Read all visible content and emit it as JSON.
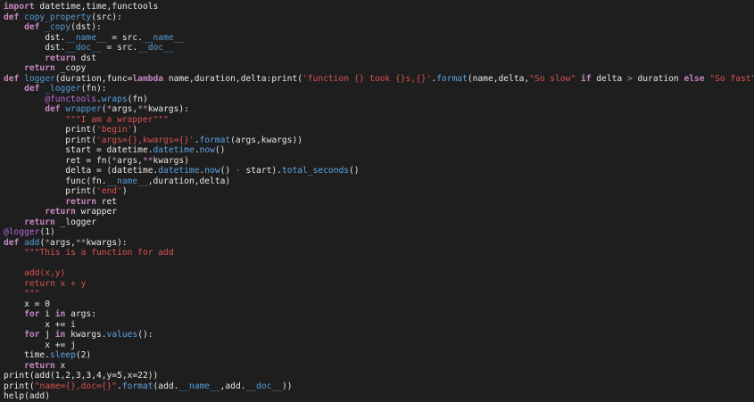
{
  "editor": {
    "language": "python",
    "colors": {
      "background": "#1e1e1e",
      "text": "#e8e8e8",
      "keyword": "#c586c0",
      "function": "#569cd6",
      "string": "#d9534f",
      "decorator": "#b96ad9"
    },
    "lines": [
      [
        {
          "t": "import",
          "c": "kw"
        },
        {
          "t": " datetime,time,functools",
          "c": ""
        }
      ],
      [
        {
          "t": "def",
          "c": "kw"
        },
        {
          "t": " ",
          "c": ""
        },
        {
          "t": "copy_property",
          "c": "fn"
        },
        {
          "t": "(src):",
          "c": ""
        }
      ],
      [
        {
          "t": "    ",
          "c": ""
        },
        {
          "t": "def",
          "c": "kw"
        },
        {
          "t": " ",
          "c": ""
        },
        {
          "t": "_copy",
          "c": "fn"
        },
        {
          "t": "(dst):",
          "c": ""
        }
      ],
      [
        {
          "t": "        dst.",
          "c": ""
        },
        {
          "t": "__name__",
          "c": "fn"
        },
        {
          "t": " = src.",
          "c": ""
        },
        {
          "t": "__name__",
          "c": "fn"
        }
      ],
      [
        {
          "t": "        dst.",
          "c": ""
        },
        {
          "t": "__doc__",
          "c": "fn"
        },
        {
          "t": " = src.",
          "c": ""
        },
        {
          "t": "__doc__",
          "c": "fn"
        }
      ],
      [
        {
          "t": "        ",
          "c": ""
        },
        {
          "t": "return",
          "c": "kw"
        },
        {
          "t": " dst",
          "c": ""
        }
      ],
      [
        {
          "t": "    ",
          "c": ""
        },
        {
          "t": "return",
          "c": "kw"
        },
        {
          "t": " _copy",
          "c": ""
        }
      ],
      [
        {
          "t": "def",
          "c": "kw"
        },
        {
          "t": " ",
          "c": ""
        },
        {
          "t": "logger",
          "c": "fn"
        },
        {
          "t": "(duration,func=",
          "c": ""
        },
        {
          "t": "lambda",
          "c": "kw"
        },
        {
          "t": " name,duration,delta:print(",
          "c": ""
        },
        {
          "t": "'function {} took {}s,{}'",
          "c": "str"
        },
        {
          "t": ".",
          "c": ""
        },
        {
          "t": "format",
          "c": "call"
        },
        {
          "t": "(name,delta,",
          "c": ""
        },
        {
          "t": "\"So slow\"",
          "c": "str"
        },
        {
          "t": " ",
          "c": ""
        },
        {
          "t": "if",
          "c": "kw"
        },
        {
          "t": " delta ",
          "c": ""
        },
        {
          "t": ">",
          "c": "op"
        },
        {
          "t": " duration ",
          "c": ""
        },
        {
          "t": "else",
          "c": "kw"
        },
        {
          "t": " ",
          "c": ""
        },
        {
          "t": "\"So fast\"",
          "c": "str"
        },
        {
          "t": "))):",
          "c": ""
        }
      ],
      [
        {
          "t": "    ",
          "c": ""
        },
        {
          "t": "def",
          "c": "kw"
        },
        {
          "t": " ",
          "c": ""
        },
        {
          "t": "_logger",
          "c": "fn"
        },
        {
          "t": "(fn):",
          "c": ""
        }
      ],
      [
        {
          "t": "        ",
          "c": ""
        },
        {
          "t": "@functools",
          "c": "dec"
        },
        {
          "t": ".",
          "c": ""
        },
        {
          "t": "wraps",
          "c": "call"
        },
        {
          "t": "(fn)",
          "c": ""
        }
      ],
      [
        {
          "t": "        ",
          "c": ""
        },
        {
          "t": "def",
          "c": "kw"
        },
        {
          "t": " ",
          "c": ""
        },
        {
          "t": "wrapper",
          "c": "fn"
        },
        {
          "t": "(",
          "c": ""
        },
        {
          "t": "*",
          "c": "op"
        },
        {
          "t": "args,",
          "c": ""
        },
        {
          "t": "**",
          "c": "op"
        },
        {
          "t": "kwargs):",
          "c": ""
        }
      ],
      [
        {
          "t": "            ",
          "c": ""
        },
        {
          "t": "\"\"\"I am a wrapper\"\"\"",
          "c": "str"
        }
      ],
      [
        {
          "t": "            print(",
          "c": ""
        },
        {
          "t": "'begin'",
          "c": "str"
        },
        {
          "t": ")",
          "c": ""
        }
      ],
      [
        {
          "t": "            print(",
          "c": ""
        },
        {
          "t": "'args={},kwargs={}'",
          "c": "str"
        },
        {
          "t": ".",
          "c": ""
        },
        {
          "t": "format",
          "c": "call"
        },
        {
          "t": "(args,kwargs))",
          "c": ""
        }
      ],
      [
        {
          "t": "            start = datetime.",
          "c": ""
        },
        {
          "t": "datetime",
          "c": "call"
        },
        {
          "t": ".",
          "c": ""
        },
        {
          "t": "now",
          "c": "call"
        },
        {
          "t": "()",
          "c": ""
        }
      ],
      [
        {
          "t": "            ret = fn(",
          "c": ""
        },
        {
          "t": "*",
          "c": "op"
        },
        {
          "t": "args,",
          "c": ""
        },
        {
          "t": "**",
          "c": "op"
        },
        {
          "t": "kwargs)",
          "c": ""
        }
      ],
      [
        {
          "t": "            delta = (datetime.",
          "c": ""
        },
        {
          "t": "datetime",
          "c": "call"
        },
        {
          "t": ".",
          "c": ""
        },
        {
          "t": "now",
          "c": "call"
        },
        {
          "t": "() ",
          "c": ""
        },
        {
          "t": "-",
          "c": "op"
        },
        {
          "t": " start).",
          "c": ""
        },
        {
          "t": "total_seconds",
          "c": "call"
        },
        {
          "t": "()",
          "c": ""
        }
      ],
      [
        {
          "t": "            func(fn.",
          "c": ""
        },
        {
          "t": "__name__",
          "c": "fn"
        },
        {
          "t": ",duration,delta)",
          "c": ""
        }
      ],
      [
        {
          "t": "            print(",
          "c": ""
        },
        {
          "t": "'end'",
          "c": "str"
        },
        {
          "t": ")",
          "c": ""
        }
      ],
      [
        {
          "t": "            ",
          "c": ""
        },
        {
          "t": "return",
          "c": "kw"
        },
        {
          "t": " ret",
          "c": ""
        }
      ],
      [
        {
          "t": "        ",
          "c": ""
        },
        {
          "t": "return",
          "c": "kw"
        },
        {
          "t": " wrapper",
          "c": ""
        }
      ],
      [
        {
          "t": "    ",
          "c": ""
        },
        {
          "t": "return",
          "c": "kw"
        },
        {
          "t": " _logger",
          "c": ""
        }
      ],
      [
        {
          "t": "@logger",
          "c": "dec"
        },
        {
          "t": "(1)",
          "c": ""
        }
      ],
      [
        {
          "t": "def",
          "c": "kw"
        },
        {
          "t": " ",
          "c": ""
        },
        {
          "t": "add",
          "c": "fn"
        },
        {
          "t": "(",
          "c": ""
        },
        {
          "t": "*",
          "c": "op"
        },
        {
          "t": "args,",
          "c": ""
        },
        {
          "t": "**",
          "c": "op"
        },
        {
          "t": "kwargs):",
          "c": ""
        }
      ],
      [
        {
          "t": "    ",
          "c": ""
        },
        {
          "t": "\"\"\"This is a function for add",
          "c": "str"
        }
      ],
      [
        {
          "t": "",
          "c": ""
        }
      ],
      [
        {
          "t": "    ",
          "c": ""
        },
        {
          "t": "add(x,y)",
          "c": "str"
        }
      ],
      [
        {
          "t": "    ",
          "c": ""
        },
        {
          "t": "return x + y",
          "c": "str"
        }
      ],
      [
        {
          "t": "    ",
          "c": ""
        },
        {
          "t": "\"\"\"",
          "c": "str"
        }
      ],
      [
        {
          "t": "    x = 0",
          "c": ""
        }
      ],
      [
        {
          "t": "    ",
          "c": ""
        },
        {
          "t": "for",
          "c": "kw"
        },
        {
          "t": " i ",
          "c": ""
        },
        {
          "t": "in",
          "c": "kw"
        },
        {
          "t": " args:",
          "c": ""
        }
      ],
      [
        {
          "t": "        x += i",
          "c": ""
        }
      ],
      [
        {
          "t": "    ",
          "c": ""
        },
        {
          "t": "for",
          "c": "kw"
        },
        {
          "t": " j ",
          "c": ""
        },
        {
          "t": "in",
          "c": "kw"
        },
        {
          "t": " kwargs.",
          "c": ""
        },
        {
          "t": "values",
          "c": "call"
        },
        {
          "t": "():",
          "c": ""
        }
      ],
      [
        {
          "t": "        x += j",
          "c": ""
        }
      ],
      [
        {
          "t": "    time.",
          "c": ""
        },
        {
          "t": "sleep",
          "c": "call"
        },
        {
          "t": "(2)",
          "c": ""
        }
      ],
      [
        {
          "t": "    ",
          "c": ""
        },
        {
          "t": "return",
          "c": "kw"
        },
        {
          "t": " x",
          "c": ""
        }
      ],
      [
        {
          "t": "print(add(1,2,3,3,4,y=5,x=22))",
          "c": ""
        }
      ],
      [
        {
          "t": "print(",
          "c": ""
        },
        {
          "t": "\"name={},doc={}\"",
          "c": "str"
        },
        {
          "t": ".",
          "c": ""
        },
        {
          "t": "format",
          "c": "call"
        },
        {
          "t": "(add.",
          "c": ""
        },
        {
          "t": "__name__",
          "c": "fn"
        },
        {
          "t": ",add.",
          "c": ""
        },
        {
          "t": "__doc__",
          "c": "fn"
        },
        {
          "t": "))",
          "c": ""
        }
      ],
      [
        {
          "t": "help(add)",
          "c": ""
        }
      ]
    ]
  }
}
